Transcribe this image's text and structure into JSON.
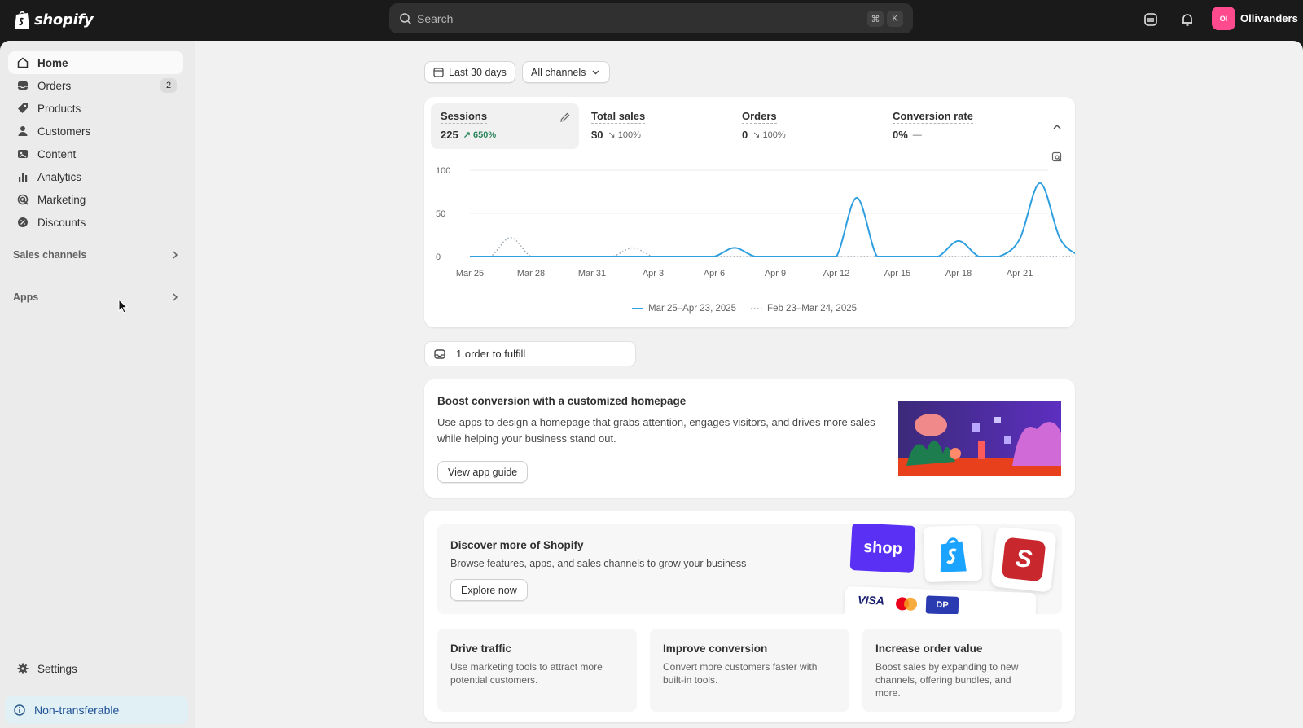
{
  "brand": {
    "name": "shopify"
  },
  "search": {
    "placeholder": "Search",
    "shortcut_cmd": "⌘",
    "shortcut_key": "K"
  },
  "store": {
    "initials": "Ol",
    "name": "Ollivanders"
  },
  "sidebar": {
    "items": [
      {
        "label": "Home",
        "icon": "home-icon",
        "active": true
      },
      {
        "label": "Orders",
        "icon": "orders-icon",
        "badge": "2"
      },
      {
        "label": "Products",
        "icon": "tag-icon"
      },
      {
        "label": "Customers",
        "icon": "person-icon"
      },
      {
        "label": "Content",
        "icon": "content-icon"
      },
      {
        "label": "Analytics",
        "icon": "bar-chart-icon"
      },
      {
        "label": "Marketing",
        "icon": "target-icon"
      },
      {
        "label": "Discounts",
        "icon": "discount-icon"
      }
    ],
    "sections": [
      {
        "label": "Sales channels"
      },
      {
        "label": "Apps"
      }
    ],
    "settings": {
      "label": "Settings"
    },
    "notice": {
      "label": "Non-transferable"
    }
  },
  "filters": {
    "date_range": "Last 30 days",
    "channels": "All channels"
  },
  "metrics": [
    {
      "label": "Sessions",
      "value": "225",
      "delta": "650%",
      "direction": "up"
    },
    {
      "label": "Total sales",
      "value": "$0",
      "delta": "100%",
      "direction": "down"
    },
    {
      "label": "Orders",
      "value": "0",
      "delta": "100%",
      "direction": "down"
    },
    {
      "label": "Conversion rate",
      "value": "0%",
      "delta": "—",
      "direction": "flat"
    }
  ],
  "chart_data": {
    "type": "line",
    "yticks": [
      "100",
      "50",
      "0"
    ],
    "ylim": [
      0,
      100
    ],
    "x": [
      "Mar 25",
      "Mar 26",
      "Mar 27",
      "Mar 28",
      "Mar 29",
      "Mar 30",
      "Mar 31",
      "Apr 1",
      "Apr 2",
      "Apr 3",
      "Apr 4",
      "Apr 5",
      "Apr 6",
      "Apr 7",
      "Apr 8",
      "Apr 9",
      "Apr 10",
      "Apr 11",
      "Apr 12",
      "Apr 13",
      "Apr 14",
      "Apr 15",
      "Apr 16",
      "Apr 17",
      "Apr 18",
      "Apr 19",
      "Apr 20",
      "Apr 21",
      "Apr 22",
      "Apr 23"
    ],
    "xtick_labels": [
      "Mar 25",
      "Mar 28",
      "Mar 31",
      "Apr 3",
      "Apr 6",
      "Apr 9",
      "Apr 12",
      "Apr 15",
      "Apr 18",
      "Apr 21"
    ],
    "series": [
      {
        "name": "Mar 25–Apr 23, 2025",
        "color": "#2f9fe0",
        "style": "solid",
        "values": [
          0,
          0,
          0,
          0,
          0,
          0,
          0,
          0,
          0,
          0,
          0,
          0,
          0,
          10,
          0,
          0,
          0,
          0,
          0,
          68,
          0,
          0,
          0,
          0,
          18,
          0,
          0,
          20,
          85,
          20,
          0
        ]
      },
      {
        "name": "Feb 23–Mar 24, 2025",
        "color": "#9aa6b2",
        "style": "dotted",
        "values": [
          0,
          0,
          22,
          0,
          0,
          0,
          0,
          0,
          10,
          0,
          0,
          0,
          0,
          0,
          0,
          0,
          0,
          0,
          0,
          0,
          0,
          0,
          0,
          0,
          0,
          0,
          0,
          0,
          0,
          0,
          0
        ]
      }
    ]
  },
  "fulfill": {
    "label": "1 order to fulfill"
  },
  "boost": {
    "title": "Boost conversion with a customized homepage",
    "body": "Use apps to design a homepage that grabs attention, engages visitors, and drives more sales while helping your business stand out.",
    "button": "View app guide"
  },
  "discover": {
    "title": "Discover more of Shopify",
    "body": "Browse features, apps, and sales channels to grow your business",
    "button": "Explore now",
    "logos": {
      "shop": "shop",
      "visa": "VISA",
      "cards": "DP"
    },
    "tiles": [
      {
        "title": "Drive traffic",
        "body": "Use marketing tools to attract more potential customers."
      },
      {
        "title": "Improve conversion",
        "body": "Convert more customers faster with built-in tools."
      },
      {
        "title": "Increase order value",
        "body": "Boost sales by expanding to new channels, offering bundles, and more."
      }
    ]
  }
}
